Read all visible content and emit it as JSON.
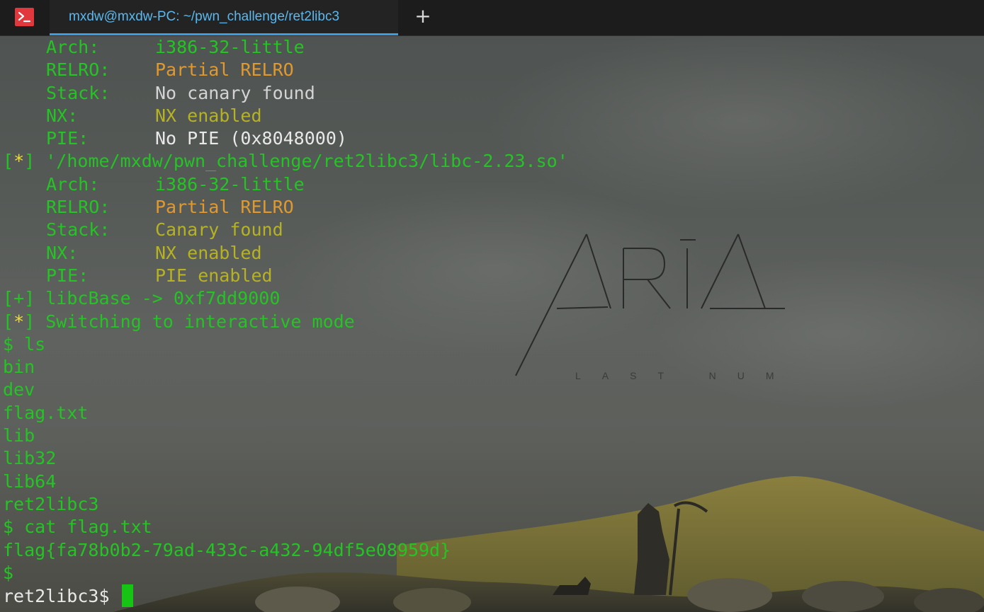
{
  "tab": {
    "title": "mxdw@mxdw-PC: ~/pwn_challenge/ret2libc3",
    "new_tab": "+"
  },
  "watermark": {
    "title": "ARIA",
    "subtitle": "LAST NUMBER"
  },
  "terminal": {
    "prompt": "ret2libc3$ ",
    "lines": [
      {
        "kind": "kv",
        "key": "Arch:",
        "value": "i386-32-little",
        "key_color": "green",
        "value_color": "green"
      },
      {
        "kind": "kv",
        "key": "RELRO:",
        "value": "Partial RELRO",
        "key_color": "green",
        "value_color": "orange"
      },
      {
        "kind": "kv",
        "key": "Stack:",
        "value": "No canary found",
        "key_color": "green",
        "value_color": "gray"
      },
      {
        "kind": "kv",
        "key": "NX:",
        "value": "NX enabled",
        "key_color": "green",
        "value_color": "olive"
      },
      {
        "kind": "kv",
        "key": "PIE:",
        "value": "No PIE (0x8048000)",
        "key_color": "green",
        "value_color": "white"
      },
      {
        "kind": "marker",
        "open": "[",
        "sym": "*",
        "close": "]",
        "text": " '/home/mxdw/pwn_challenge/ret2libc3/libc-2.23.so'"
      },
      {
        "kind": "kv",
        "key": "Arch:",
        "value": "i386-32-little",
        "key_color": "green",
        "value_color": "green"
      },
      {
        "kind": "kv",
        "key": "RELRO:",
        "value": "Partial RELRO",
        "key_color": "green",
        "value_color": "orange"
      },
      {
        "kind": "kv",
        "key": "Stack:",
        "value": "Canary found",
        "key_color": "green",
        "value_color": "olive"
      },
      {
        "kind": "kv",
        "key": "NX:",
        "value": "NX enabled",
        "key_color": "green",
        "value_color": "olive"
      },
      {
        "kind": "kv",
        "key": "PIE:",
        "value": "PIE enabled",
        "key_color": "green",
        "value_color": "olive"
      },
      {
        "kind": "marker",
        "open": "[",
        "sym": "+",
        "close": "]",
        "text": " libcBase -> 0xf7dd9000",
        "sym_color": "green"
      },
      {
        "kind": "marker",
        "open": "[",
        "sym": "*",
        "close": "]",
        "text": " Switching to interactive mode"
      },
      {
        "kind": "plain",
        "text": "$ ls",
        "color": "green"
      },
      {
        "kind": "plain",
        "text": "bin",
        "color": "green"
      },
      {
        "kind": "plain",
        "text": "dev",
        "color": "green"
      },
      {
        "kind": "plain",
        "text": "flag.txt",
        "color": "green"
      },
      {
        "kind": "plain",
        "text": "lib",
        "color": "green"
      },
      {
        "kind": "plain",
        "text": "lib32",
        "color": "green"
      },
      {
        "kind": "plain",
        "text": "lib64",
        "color": "green"
      },
      {
        "kind": "plain",
        "text": "ret2libc3",
        "color": "green"
      },
      {
        "kind": "plain",
        "text": "$ cat flag.txt",
        "color": "green"
      },
      {
        "kind": "plain",
        "text": "flag{fa78b0b2-79ad-433c-a432-94df5e08959d}",
        "color": "green"
      },
      {
        "kind": "plain",
        "text": "$",
        "color": "green"
      }
    ]
  },
  "colors": {
    "green": "#24c424",
    "gray": "#d3d3d3",
    "orange": "#e0992e",
    "olive": "#b6b223",
    "yellow": "#ecdc3a",
    "white": "#e8e8e8",
    "tab_accent": "#3a9ee0",
    "app_icon": "#e0383d"
  },
  "icons": {
    "app": "terminal-app-icon",
    "new_tab": "plus-icon"
  }
}
